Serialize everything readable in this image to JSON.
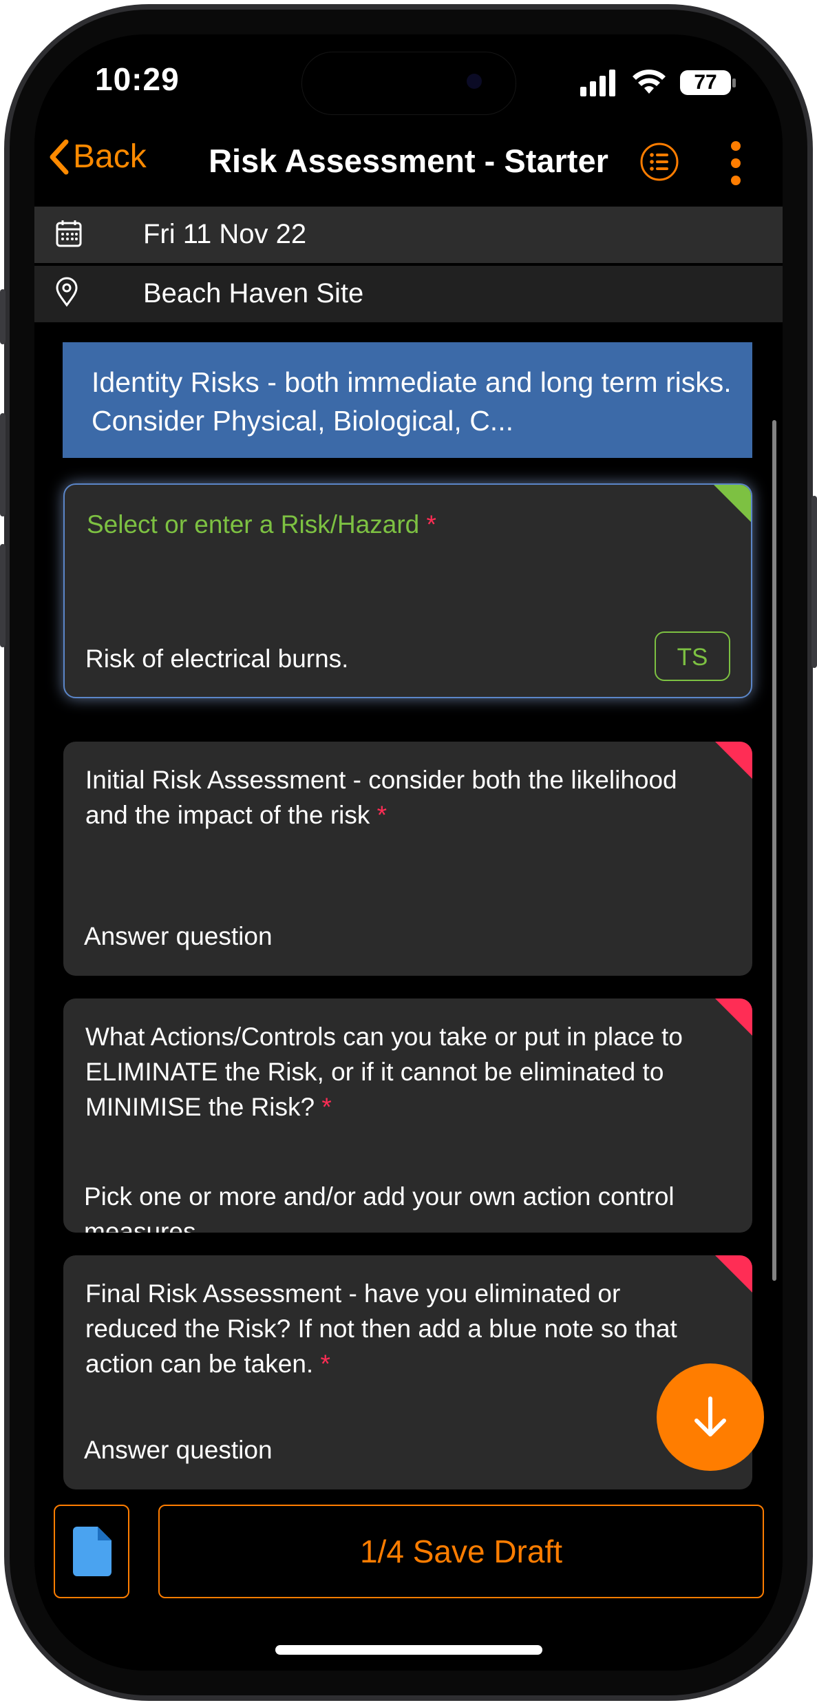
{
  "status_bar": {
    "time": "10:29",
    "battery": "77"
  },
  "nav": {
    "back_label": "Back",
    "title": "Risk Assessment - Starter"
  },
  "info": {
    "date": "Fri 11 Nov 22",
    "location": "Beach Haven Site"
  },
  "banner": {
    "text": "Identity Risks - both immediate and long term risks. Consider Physical, Biological, C..."
  },
  "cards": [
    {
      "question": "Select or enter a Risk/Hazard",
      "answer": "Risk of electrical burns.",
      "badge": "TS",
      "status_color": "#7dc142"
    },
    {
      "question": "Initial Risk Assessment - consider both the likelihood and the impact of the risk",
      "answer": "Answer question",
      "status_color": "#ff2d55"
    },
    {
      "question": "What Actions/Controls can you take or put in place to ELIMINATE the Risk, or if it cannot be eliminated to MINIMISE the Risk?",
      "answer": "Pick one or more and/or add your own action control measures",
      "status_color": "#ff2d55"
    },
    {
      "question": "Final Risk Assessment - have you eliminated or reduced the Risk? If not then add a blue note so that action can be taken.",
      "answer": "Answer question",
      "status_color": "#ff2d55"
    }
  ],
  "required_marker": "*",
  "footer": {
    "save_label": "1/4 Save Draft"
  },
  "colors": {
    "accent": "#ff7d00",
    "banner": "#3c6aa8",
    "required": "#ff2d55",
    "answered": "#7dc142"
  },
  "icons": [
    "chevron-left-icon",
    "list-icon",
    "more-vertical-icon",
    "calendar-icon",
    "location-pin-icon",
    "arrow-down-icon",
    "document-icon",
    "signal-icon",
    "wifi-icon",
    "battery-icon"
  ]
}
